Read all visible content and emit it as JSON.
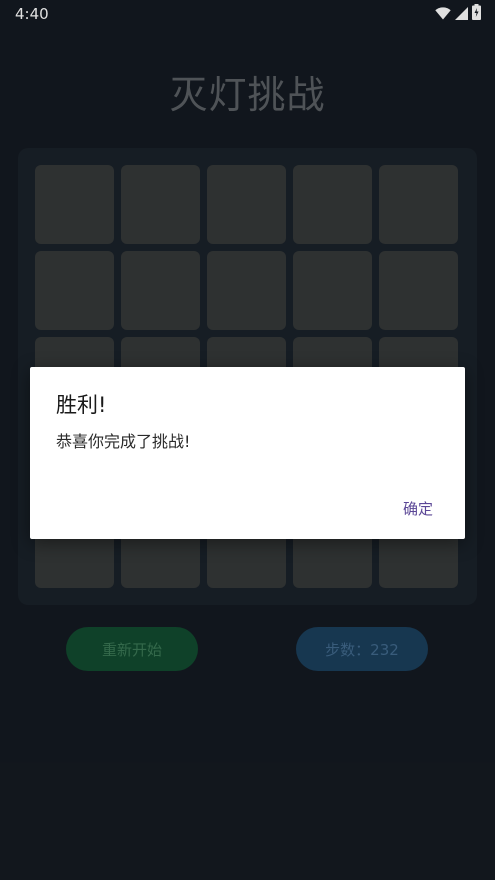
{
  "status_bar": {
    "time": "4:40",
    "icons": [
      "wifi-icon",
      "cell-signal-icon",
      "battery-icon"
    ]
  },
  "app": {
    "title": "灭灯挑战"
  },
  "board": {
    "rows": 5,
    "cols": 5,
    "cell_state": "off",
    "cell_color": "#353838"
  },
  "controls": {
    "restart_label": "重新开始",
    "steps_label": "步数：232"
  },
  "dialog": {
    "title": "胜利!",
    "message": "恭喜你完成了挑战!",
    "ok_label": "确定"
  },
  "colors": {
    "background": "#141a21",
    "board": "#1a2129",
    "restart": "#124a2f",
    "steps": "#1b3f5c",
    "accent": "#5b4796"
  }
}
